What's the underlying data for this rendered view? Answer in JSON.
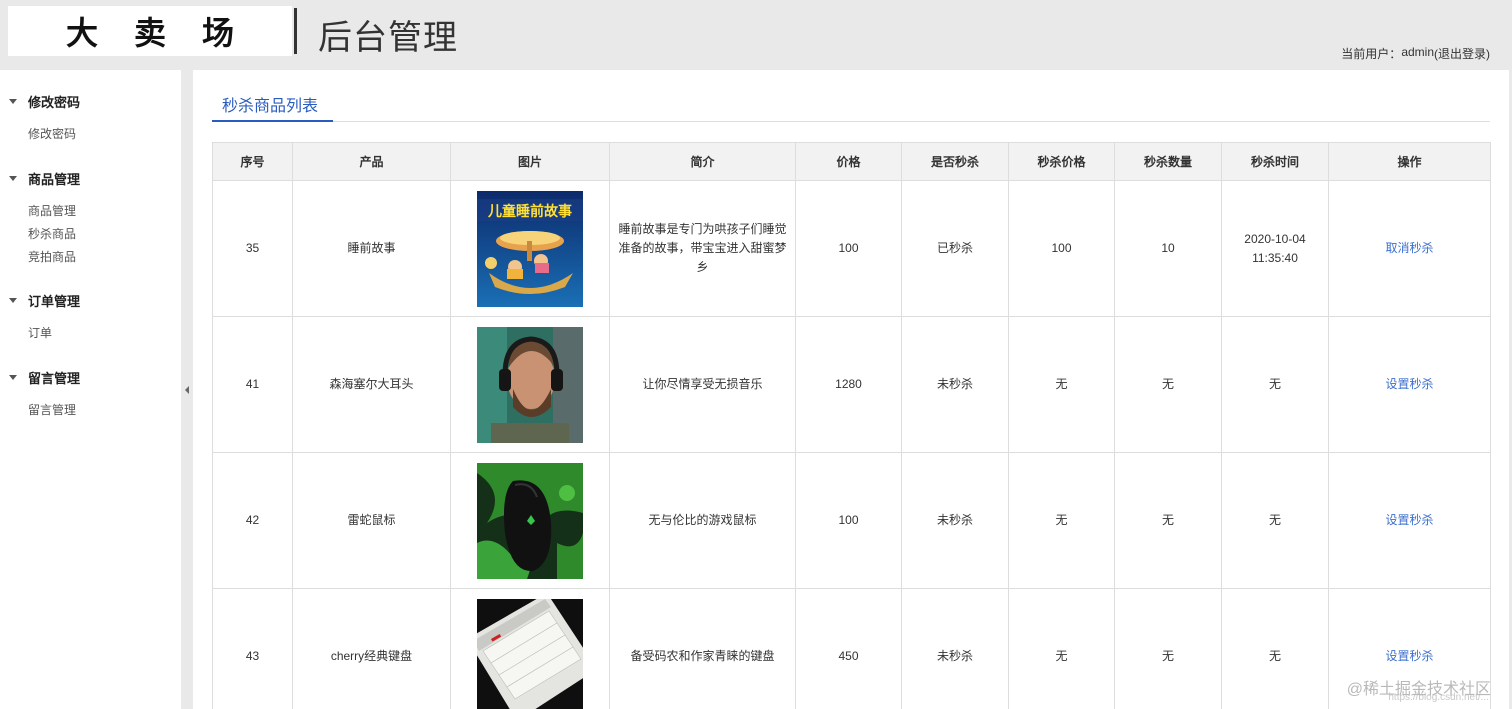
{
  "header": {
    "logo": "大卖场",
    "title": "后台管理",
    "user_prefix": "当前用户：",
    "username": "admin",
    "logout": "(退出登录)"
  },
  "sidebar": {
    "groups": [
      {
        "title": "修改密码",
        "items": [
          "修改密码"
        ]
      },
      {
        "title": "商品管理",
        "items": [
          "商品管理",
          "秒杀商品",
          "竞拍商品"
        ]
      },
      {
        "title": "订单管理",
        "items": [
          "订单"
        ]
      },
      {
        "title": "留言管理",
        "items": [
          "留言管理"
        ]
      }
    ]
  },
  "main": {
    "tab": "秒杀商品列表",
    "columns": [
      "序号",
      "产品",
      "图片",
      "简介",
      "价格",
      "是否秒杀",
      "秒杀价格",
      "秒杀数量",
      "秒杀时间",
      "操作"
    ],
    "rows": [
      {
        "id": "35",
        "product": "睡前故事",
        "image_icon": "bedtime-story-cover",
        "image_caption": "儿童睡前故事",
        "desc": "睡前故事是专门为哄孩子们睡觉准备的故事，带宝宝进入甜蜜梦乡",
        "price": "100",
        "is_seckill": "已秒杀",
        "seckill_price": "100",
        "seckill_qty": "10",
        "seckill_time": "2020-10-04 11:35:40",
        "action": "取消秒杀"
      },
      {
        "id": "41",
        "product": "森海塞尔大耳头",
        "image_icon": "headphones-photo",
        "desc": "让你尽情享受无损音乐",
        "price": "1280",
        "is_seckill": "未秒杀",
        "seckill_price": "无",
        "seckill_qty": "无",
        "seckill_time": "无",
        "action": "设置秒杀"
      },
      {
        "id": "42",
        "product": "雷蛇鼠标",
        "image_icon": "mouse-photo",
        "desc": "无与伦比的游戏鼠标",
        "price": "100",
        "is_seckill": "未秒杀",
        "seckill_price": "无",
        "seckill_qty": "无",
        "seckill_time": "无",
        "action": "设置秒杀"
      },
      {
        "id": "43",
        "product": "cherry经典键盘",
        "image_icon": "keyboard-photo",
        "desc": "备受码农和作家青睐的键盘",
        "price": "450",
        "is_seckill": "未秒杀",
        "seckill_price": "无",
        "seckill_qty": "无",
        "seckill_time": "无",
        "action": "设置秒杀"
      }
    ]
  },
  "watermark": "@稀土掘金技术社区",
  "watermark_url": "https://blog.csdn.net/..."
}
